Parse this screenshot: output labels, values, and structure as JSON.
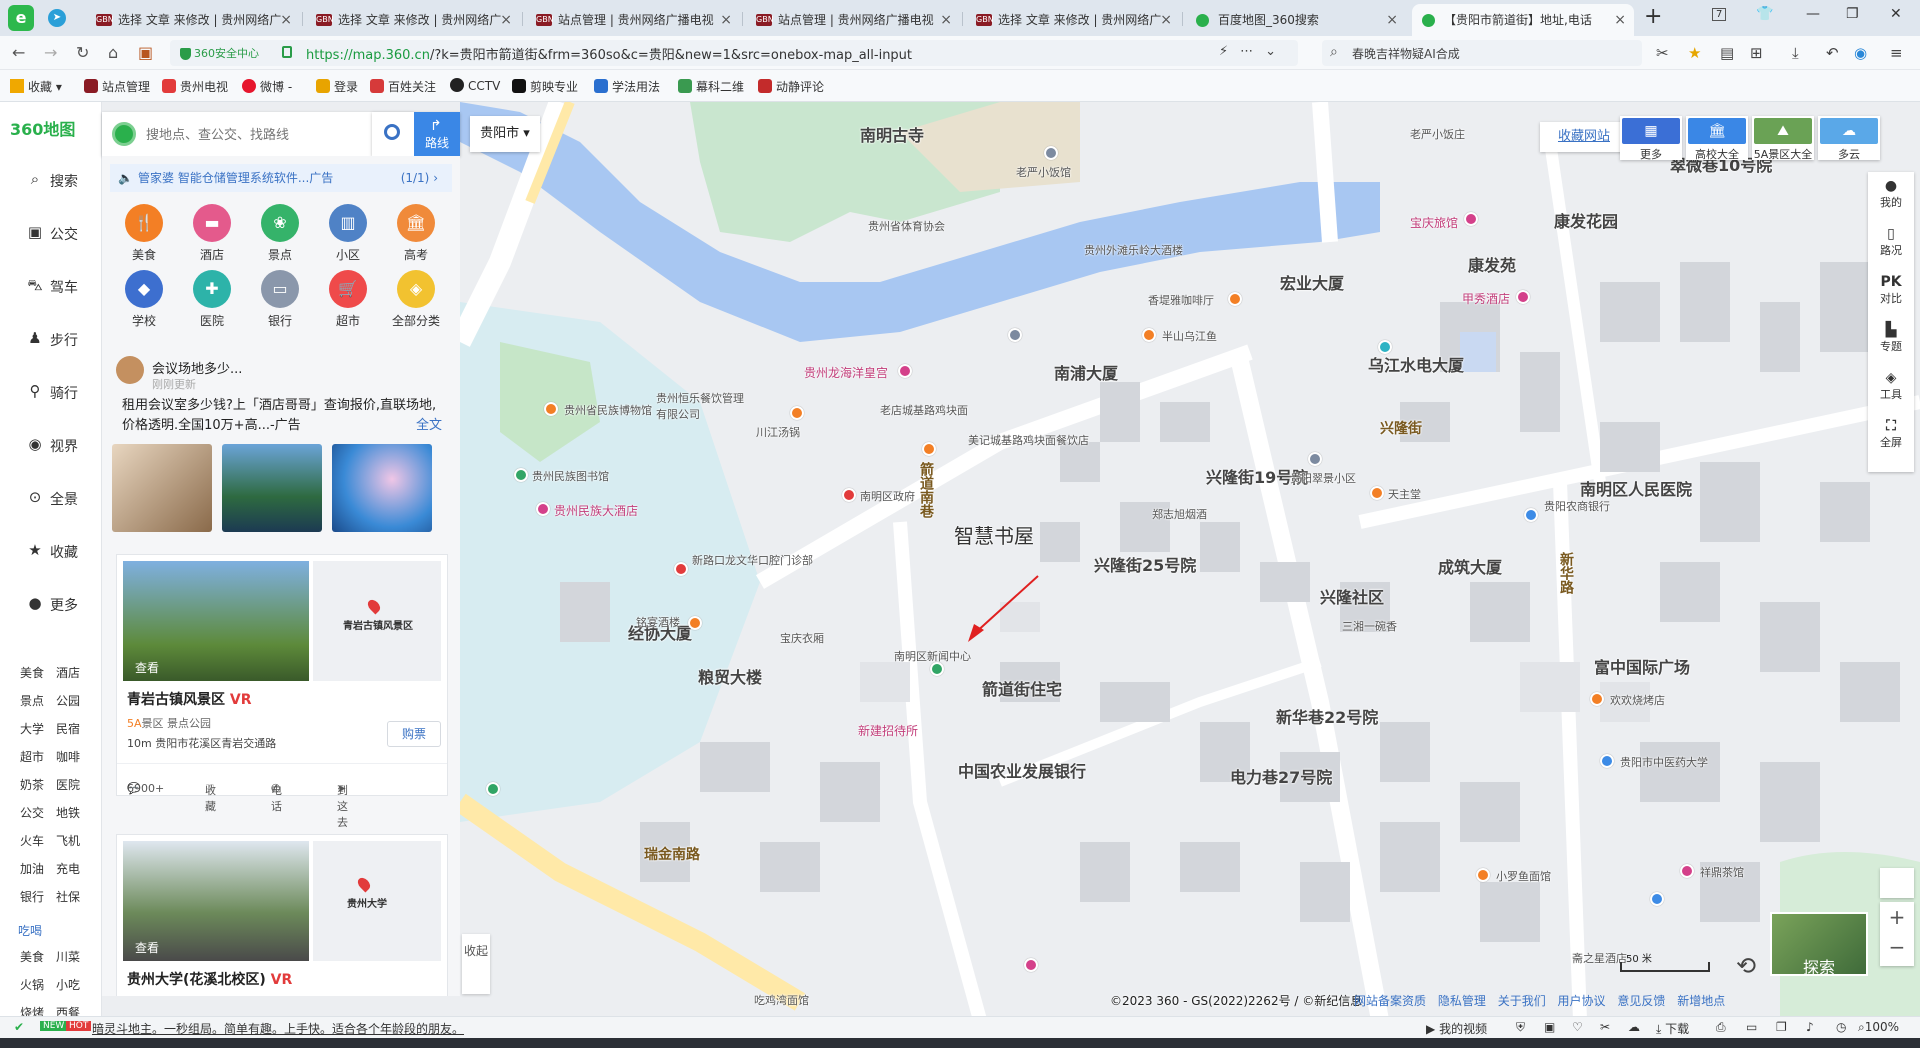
{
  "browser": {
    "tabs": [
      {
        "label": "选择 文章 来修改 | 贵州网络广",
        "active": false
      },
      {
        "label": "选择 文章 来修改 | 贵州网络广",
        "active": false
      },
      {
        "label": "站点管理 | 贵州网络广播电视",
        "active": false
      },
      {
        "label": "站点管理 | 贵州网络广播电视",
        "active": false
      },
      {
        "label": "选择 文章 来修改 | 贵州网络广",
        "active": false
      },
      {
        "label": "百度地图_360搜索",
        "active": false
      },
      {
        "label": "【贵阳市箭道街】地址,电话",
        "active": true
      }
    ],
    "tab_count_badge": "7",
    "security_label": "360安全中心",
    "url_host": "https://map.360.cn",
    "url_rest": "/?k=贵阳市箭道街&frm=360so&c=贵阳&new=1&src=onebox-map_all-input",
    "search_text": "春晚吉祥物疑AI合成",
    "bookmarks": [
      "收藏",
      "站点管理",
      "贵州电视",
      "微博 -",
      "登录",
      "百姓关注",
      "CCTV",
      "剪映专业",
      "学法用法",
      "幕科二维",
      "动静评论"
    ]
  },
  "sidebar": {
    "brand": "360地图",
    "items": [
      {
        "icon": "search-icon",
        "label": "搜索"
      },
      {
        "icon": "bus-icon",
        "label": "公交"
      },
      {
        "icon": "car-icon",
        "label": "驾车"
      },
      {
        "icon": "walk-icon",
        "label": "步行"
      },
      {
        "icon": "bike-icon",
        "label": "骑行"
      },
      {
        "icon": "eye-icon",
        "label": "视界"
      },
      {
        "icon": "panorama-icon",
        "label": "全景"
      },
      {
        "icon": "star-icon",
        "label": "收藏"
      },
      {
        "icon": "more-icon",
        "label": "更多"
      }
    ],
    "quick": [
      "美食",
      "酒店",
      "景点",
      "公园",
      "大学",
      "民宿",
      "超市",
      "咖啡",
      "奶茶",
      "医院",
      "公交",
      "地铁",
      "火车",
      "飞机",
      "加油",
      "充电",
      "银行",
      "社保"
    ],
    "eat_link": "吃喝",
    "quick2": [
      "美食",
      "川菜",
      "火锅",
      "小吃",
      "烧烤",
      "西餐"
    ]
  },
  "search": {
    "placeholder": "搜地点、查公交、找路线",
    "route_label": "路线",
    "city": "贵阳市"
  },
  "panel": {
    "ad_text": "管家婆 智能仓储管理系统软件...广告",
    "ad_count": "(1/1)",
    "categories": [
      {
        "label": "美食",
        "color": "#f37f25",
        "icon": "fork-icon"
      },
      {
        "label": "酒店",
        "color": "#e45a8c",
        "icon": "bed-icon"
      },
      {
        "label": "景点",
        "color": "#35b36a",
        "icon": "scenic-icon"
      },
      {
        "label": "小区",
        "color": "#4f82c6",
        "icon": "building-icon"
      },
      {
        "label": "高考",
        "color": "#f08a3a",
        "icon": "school-icon"
      },
      {
        "label": "学校",
        "color": "#3d6fcf",
        "icon": "cap-icon"
      },
      {
        "label": "医院",
        "color": "#2db3a9",
        "icon": "hospital-icon"
      },
      {
        "label": "银行",
        "color": "#8a97ab",
        "icon": "card-icon"
      },
      {
        "label": "超市",
        "color": "#ef4a4a",
        "icon": "cart-icon"
      },
      {
        "label": "全部分类",
        "color": "#f2c230",
        "icon": "layers-icon"
      }
    ],
    "news": {
      "title": "会议场地多少...",
      "sub": "刚刚更新",
      "body": "租用会议室多少钱?上「酒店哥哥」查询报价,直联场地,价格透明.全国10万+高...-广告",
      "more": "全文"
    },
    "cards": [
      {
        "title": "青岩古镇风景区",
        "vr": "VR",
        "level": "5A",
        "meta": "景区 景点公园",
        "addr": "10m 贵阳市花溪区青岩交通路",
        "buy": "购票",
        "view": "查看",
        "map_label": "青岩古镇风景区",
        "comments": "6900+",
        "fav": "收藏",
        "phone": "电话",
        "go": "到这去"
      },
      {
        "title": "贵州大学(花溪北校区)",
        "vr": "VR",
        "view": "查看",
        "map_label": "贵州大学"
      }
    ],
    "collapse": "收起"
  },
  "map_controls": {
    "fav_site": "收藏网站",
    "top_buttons": [
      {
        "label": "更多",
        "color": "#3b6fd6"
      },
      {
        "label": "高校大全",
        "color": "#3a87e6"
      },
      {
        "label": "5A景区大全",
        "color": "#6aa255"
      },
      {
        "label": "多云",
        "color": "#5aa8e8"
      }
    ],
    "side": [
      "我的",
      "路况",
      "对比",
      "专题",
      "工具",
      "全屏"
    ],
    "side_icons": [
      "PK"
    ],
    "explore": "探索",
    "scale": "50 米",
    "copyright": "©2023 360 - GS(2022)2262号 / ©新纪信息",
    "footer_links": [
      "网站备案资质",
      "隐私管理",
      "关于我们",
      "用户协议",
      "意见反馈",
      "新增地点"
    ]
  },
  "map_labels": {
    "areas": [
      "南明古寺",
      "南浦大厦",
      "宏业大厦",
      "乌江水电大厦",
      "兴隆街19号院",
      "兴隆街25号院",
      "兴隆社区",
      "成筑大厦",
      "康发花园",
      "康发苑",
      "翠微巷10号院",
      "南明区人民医院",
      "富中国际广场",
      "新华巷22号院",
      "电力巷27号院",
      "箭道街住宅",
      "中国农业发展银行",
      "粮贸大楼",
      "经协大厦"
    ],
    "highlight": "智慧书屋",
    "roads": [
      "箭道南巷",
      "兴隆街",
      "新华路",
      "瑞金南路"
    ],
    "pois": [
      "贵州龙海洋皇宫",
      "贵州民族大酒店",
      "宝庆旅馆",
      "甲秀酒店",
      "贵州省民族博物馆",
      "贵州民族图书馆",
      "川江汤锅",
      "老店城基路鸡块面",
      "美记城基路鸡块面餐饮店",
      "南明区政府",
      "新路口龙文华口腔门诊部",
      "铭宴酒楼",
      "南明区新闻中心",
      "新建招待所",
      "贵州外滩乐岭大酒楼",
      "香堤雅咖啡厅",
      "半山乌江鱼",
      "郑志旭烟酒",
      "天主堂",
      "老严小饭庄",
      "贵阳农商银行",
      "贵阳市中医药大学",
      "欢欢烧烤店",
      "祥鼎茶馆",
      "斋之星酒店",
      "吃鸡湾面馆",
      "小罗鱼面馆",
      "贵州省体育协会",
      "老严小饭馆",
      "贵州恒乐餐饮管理有限公司",
      "贵阳翠景小区",
      "三湘一碗香",
      "宝庆衣厢"
    ]
  },
  "statusbar": {
    "new_badge": "NEW",
    "hot_badge": "HOT",
    "text": "暗灵斗地主。一秒组局。简单有趣。上手快。适合各个年龄段的朋友。",
    "right": [
      "我的视频",
      "下载",
      "100%"
    ]
  }
}
